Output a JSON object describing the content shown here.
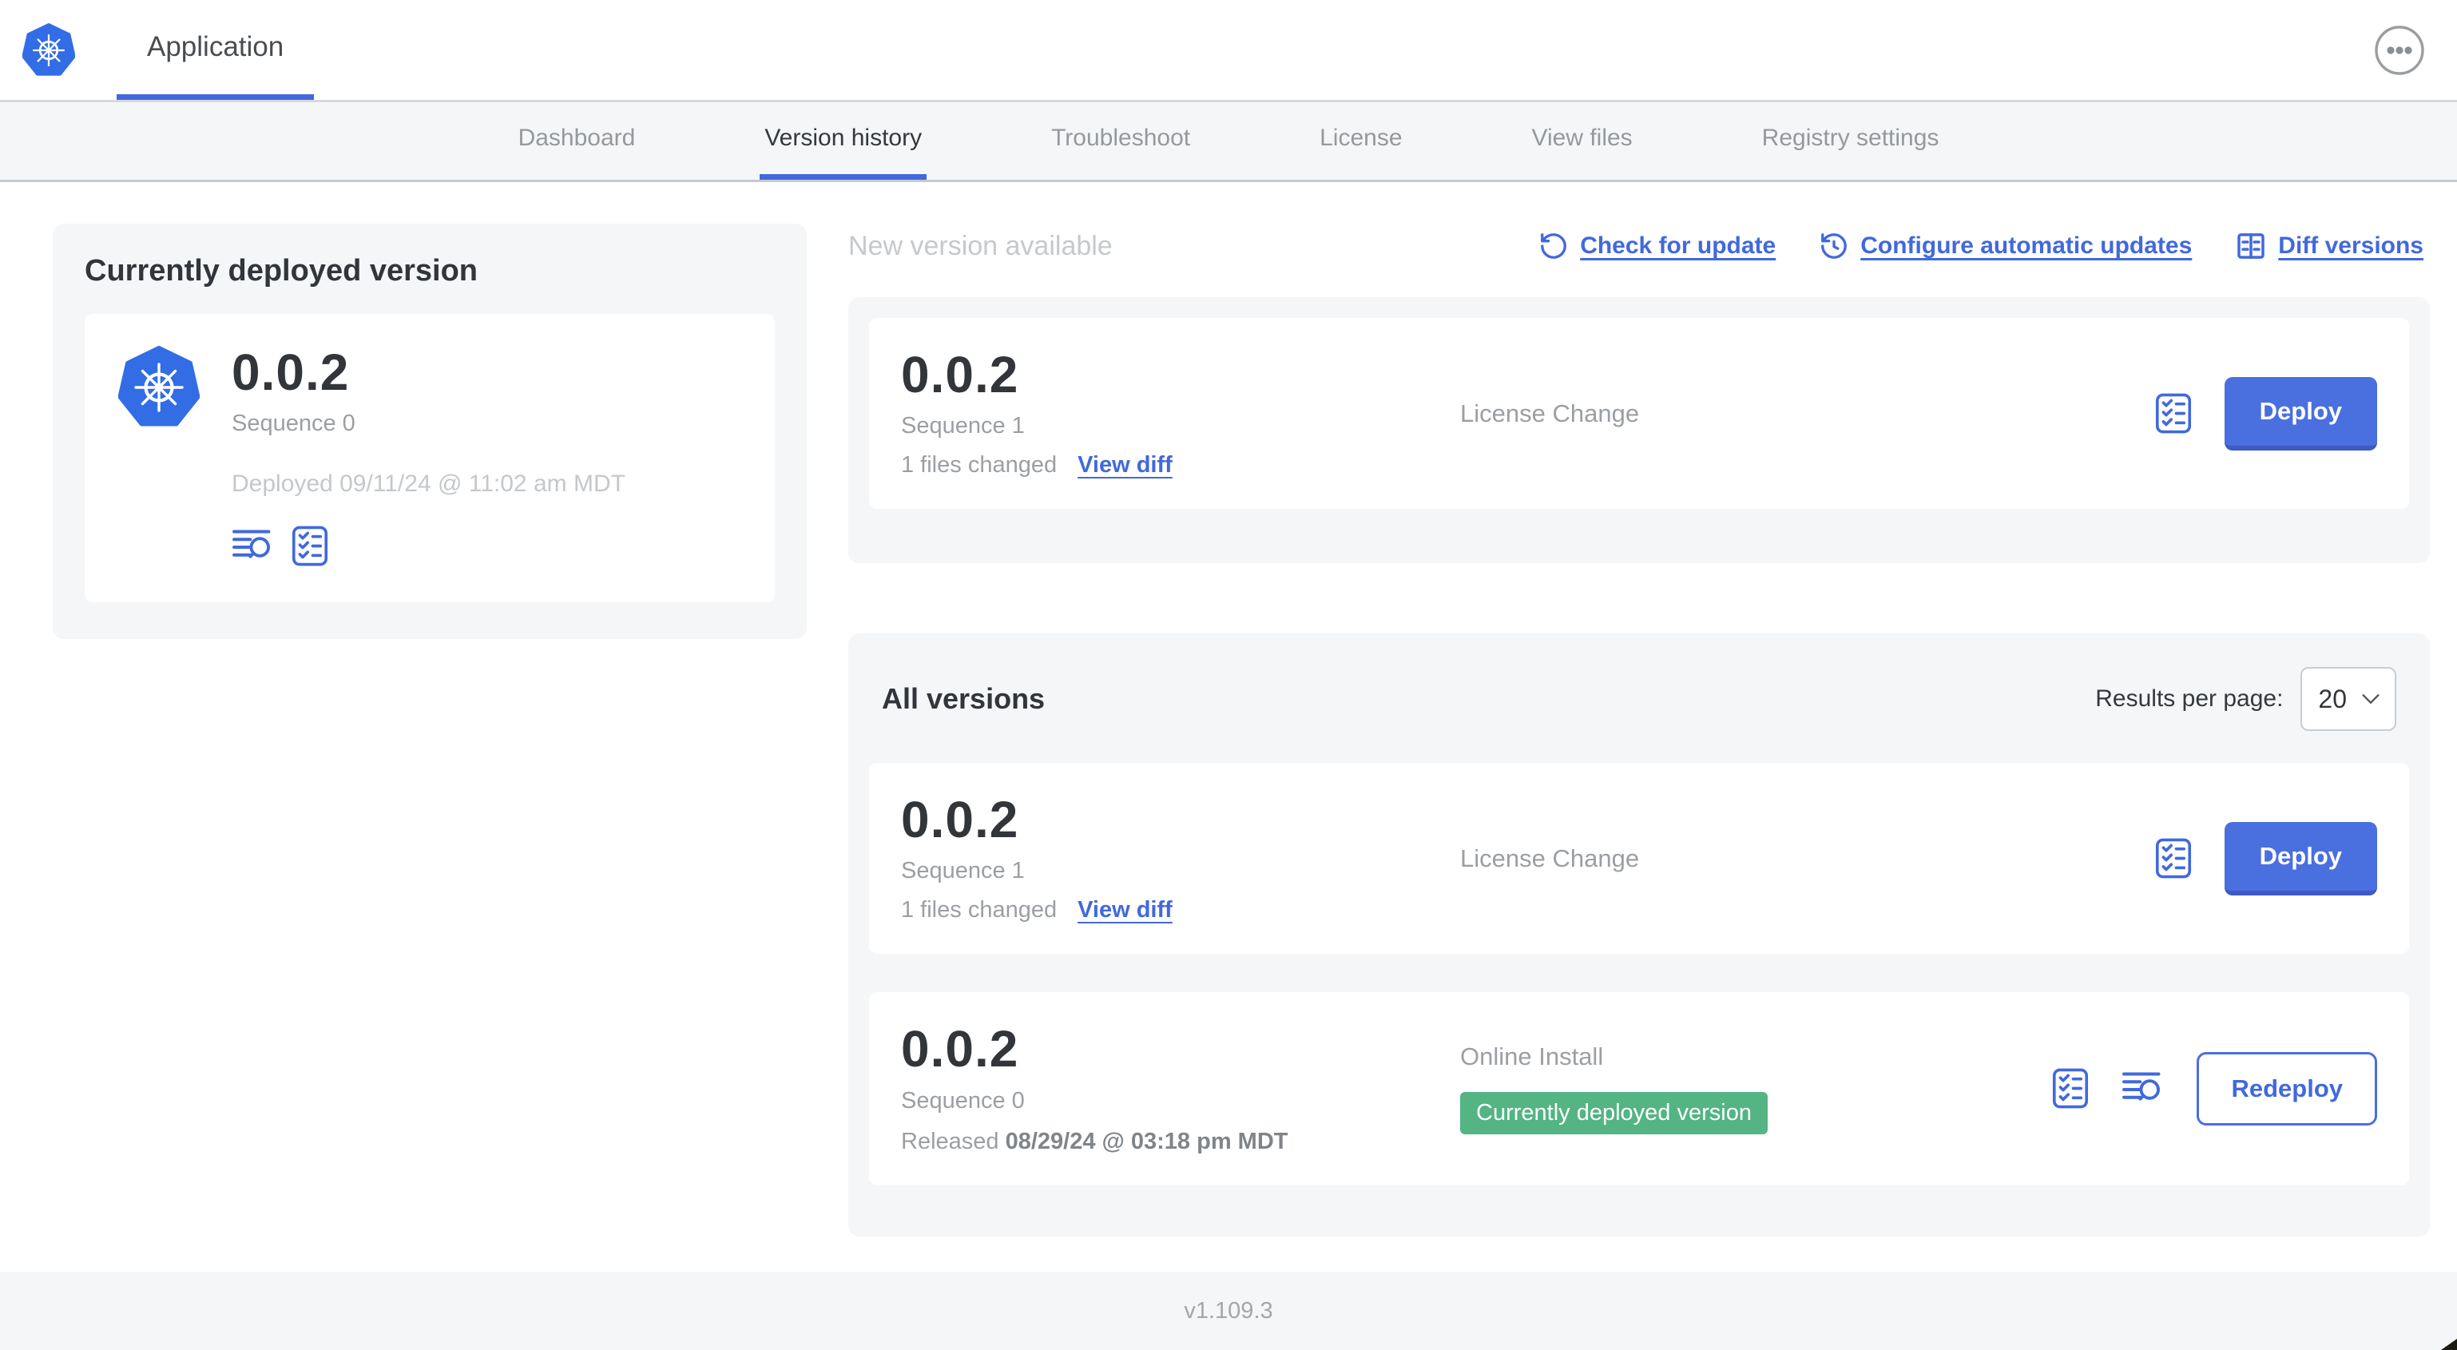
{
  "colors": {
    "accent_button": "#4A6FDE",
    "link_blue": "#4169DD",
    "kubernetes_blue": "#326DE6",
    "success_badge_green": "#54B483",
    "panel_gray": "#F4F6F8"
  },
  "icons": {
    "app_logo": "kubernetes-wheel-logo",
    "overflow_menu": "ellipsis-in-circle",
    "check_for_update": "rotate-ccw-refresh",
    "configure_automatic_updates": "clock-refresh",
    "diff_versions": "split-diff",
    "version_checks": "checklist",
    "logs": "lines-with-magnifier",
    "results_select": "chevron-down"
  },
  "header": {
    "title": "Application"
  },
  "nav": {
    "tabs": [
      {
        "label": "Dashboard",
        "active": false
      },
      {
        "label": "Version history",
        "active": true
      },
      {
        "label": "Troubleshoot",
        "active": false
      },
      {
        "label": "License",
        "active": false
      },
      {
        "label": "View files",
        "active": false
      },
      {
        "label": "Registry settings",
        "active": false
      }
    ]
  },
  "current_version": {
    "title": "Currently deployed version",
    "version": "0.0.2",
    "sequence": "Sequence 0",
    "deployed": "Deployed 09/11/24 @ 11:02 am MDT"
  },
  "new_version": {
    "title": "New version available",
    "actions": [
      {
        "label": "Check for update"
      },
      {
        "label": "Configure automatic updates"
      },
      {
        "label": "Diff versions"
      }
    ],
    "card": {
      "version": "0.0.2",
      "sequence": "Sequence 1",
      "files_changed": "1 files changed",
      "view_diff": "View diff",
      "source": "License Change",
      "action_label": "Deploy"
    }
  },
  "all_versions": {
    "title": "All versions",
    "results_per_page_label": "Results per page:",
    "results_per_page_value": "20",
    "rows": [
      {
        "version": "0.0.2",
        "sequence": "Sequence 1",
        "files_changed": "1 files changed",
        "view_diff": "View diff",
        "source": "License Change",
        "action_label": "Deploy"
      },
      {
        "version": "0.0.2",
        "sequence": "Sequence 0",
        "released_prefix": "Released ",
        "released_date": "08/29/24 @ 03:18 pm MDT",
        "source": "Online Install",
        "badge": "Currently deployed version",
        "action_label": "Redeploy"
      }
    ]
  },
  "footer": {
    "app_version": "v1.109.3"
  }
}
